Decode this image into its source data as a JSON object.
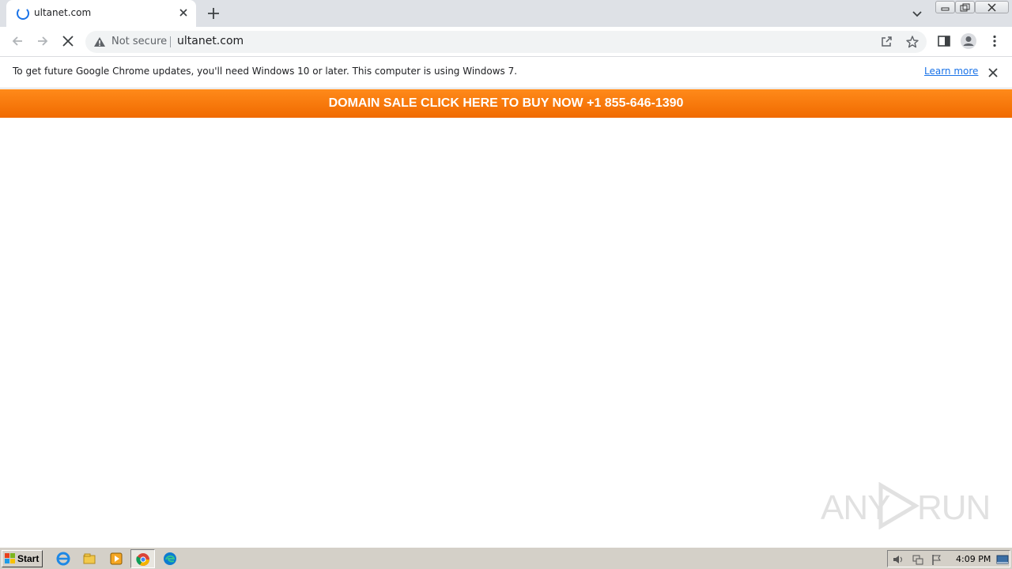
{
  "browser": {
    "tab": {
      "title": "ultanet.com"
    },
    "address_bar": {
      "security_label": "Not secure",
      "url": "ultanet.com"
    }
  },
  "infobar": {
    "message": "To get future Google Chrome updates, you'll need Windows 10 or later. This computer is using Windows 7.",
    "link_label": "Learn more"
  },
  "page": {
    "banner_text": "DOMAIN SALE CLICK HERE TO BUY NOW +1 855-646-1390",
    "banner_color": "#f57c00"
  },
  "watermark": {
    "left": "ANY",
    "right": "RUN"
  },
  "taskbar": {
    "start_label": "Start",
    "apps": [
      "internet-explorer-icon",
      "file-explorer-icon",
      "media-player-icon",
      "chrome-icon",
      "edge-icon"
    ],
    "clock": "4:09 PM"
  }
}
